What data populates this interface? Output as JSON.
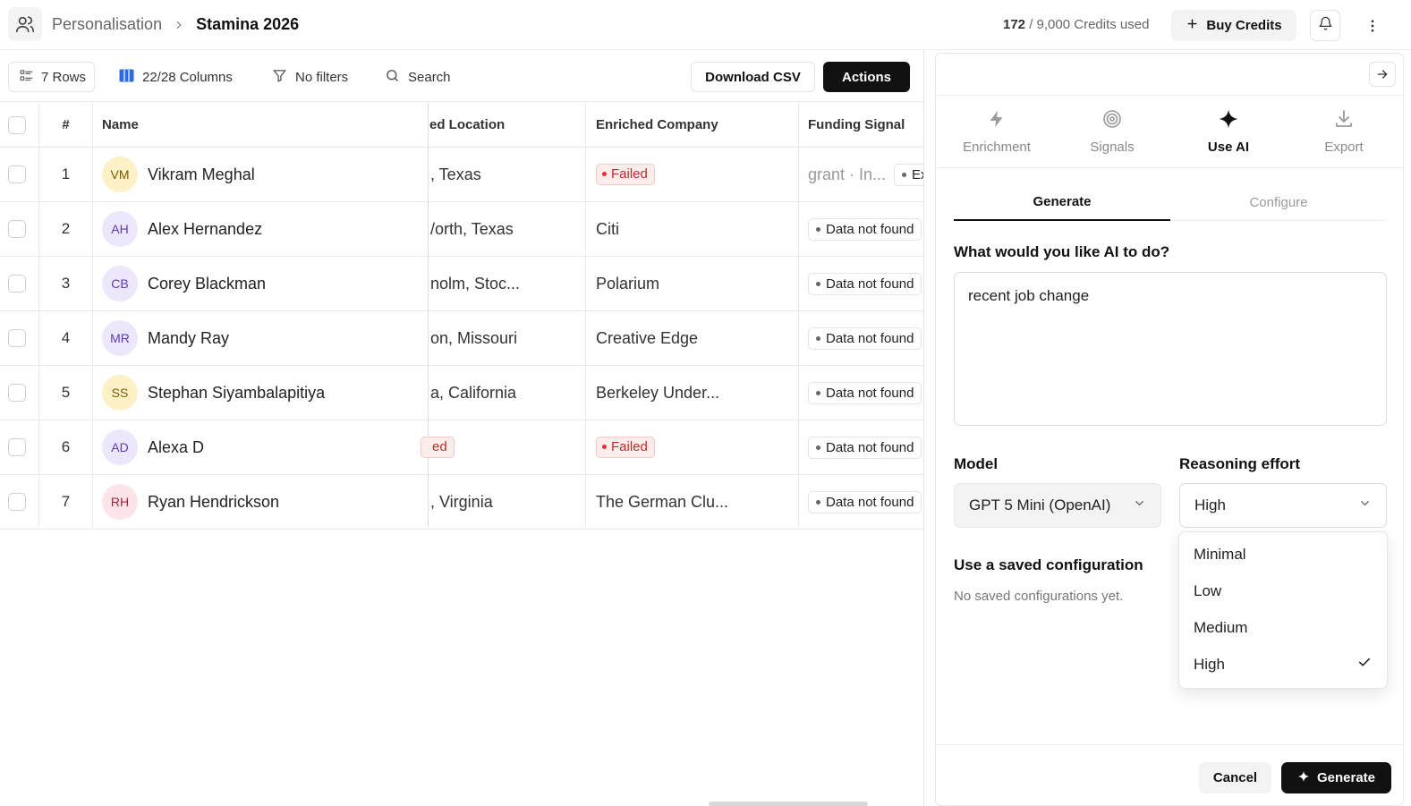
{
  "header": {
    "breadcrumb_parent": "Personalisation",
    "breadcrumb_current": "Stamina 2026",
    "credits_used": "172",
    "credits_total": "/ 9,000 Credits used",
    "buy_credits_label": "Buy Credits"
  },
  "toolbar": {
    "rows_label": "7 Rows",
    "columns_label": "22/28 Columns",
    "filters_label": "No filters",
    "search_label": "Search",
    "download_label": "Download CSV",
    "actions_label": "Actions"
  },
  "table": {
    "columns": [
      "#",
      "Name",
      "ed Location",
      "Enriched Company",
      "Funding Signal"
    ],
    "rows": [
      {
        "num": "1",
        "initials": "VM",
        "name": "Vikram Meghal",
        "location": ", Texas",
        "company": "Failed",
        "funding": "grant · In...",
        "funding_extra": "Ex"
      },
      {
        "num": "2",
        "initials": "AH",
        "name": "Alex Hernandez",
        "location": "/orth, Texas",
        "company": "Citi",
        "funding": "Data not found"
      },
      {
        "num": "3",
        "initials": "CB",
        "name": "Corey Blackman",
        "location": "nolm, Stoc...",
        "company": "Polarium",
        "funding": "Data not found"
      },
      {
        "num": "4",
        "initials": "MR",
        "name": "Mandy Ray",
        "location": "on, Missouri",
        "company": "Creative Edge",
        "funding": "Data not found"
      },
      {
        "num": "5",
        "initials": "SS",
        "name": "Stephan Siyambalapitiya",
        "location": "a, California",
        "company": "Berkeley Under...",
        "funding": "Data not found"
      },
      {
        "num": "6",
        "initials": "AD",
        "name": "Alexa D",
        "location": "ed",
        "company": "Failed",
        "funding": "Data not found"
      },
      {
        "num": "7",
        "initials": "RH",
        "name": "Ryan Hendrickson",
        "location": ", Virginia",
        "company": "The German Clu...",
        "funding": "Data not found"
      }
    ]
  },
  "panel": {
    "tabs": [
      "Enrichment",
      "Signals",
      "Use AI",
      "Export"
    ],
    "active_tab": "Use AI",
    "subtabs": [
      "Generate",
      "Configure"
    ],
    "question_label": "What would you like AI to do?",
    "prompt_value": "recent job change",
    "model_label": "Model",
    "model_value": "GPT 5 Mini (OpenAI)",
    "effort_label": "Reasoning effort",
    "effort_value": "High",
    "effort_options": [
      "Minimal",
      "Low",
      "Medium",
      "High"
    ],
    "saved_title": "Use a saved configuration",
    "saved_empty": "No saved configurations yet.",
    "cancel_label": "Cancel",
    "generate_label": "Generate"
  },
  "colors": {
    "accent": "#111111",
    "failed_red": "#c42b2b",
    "avatar_yellow": "#fdf1c7",
    "avatar_purple": "#ede7fb",
    "avatar_pink": "#fde4e8",
    "columns_icon_blue": "#2d6be3"
  },
  "icons": [
    "users-icon",
    "chevron-right-icon",
    "plus-icon",
    "bell-icon",
    "more-vertical-icon",
    "rows-icon",
    "columns-icon",
    "filter-icon",
    "search-icon",
    "arrow-right-icon",
    "lightning-icon",
    "signals-icon",
    "sparkle-icon",
    "download-icon",
    "chevron-down-icon",
    "check-icon"
  ]
}
